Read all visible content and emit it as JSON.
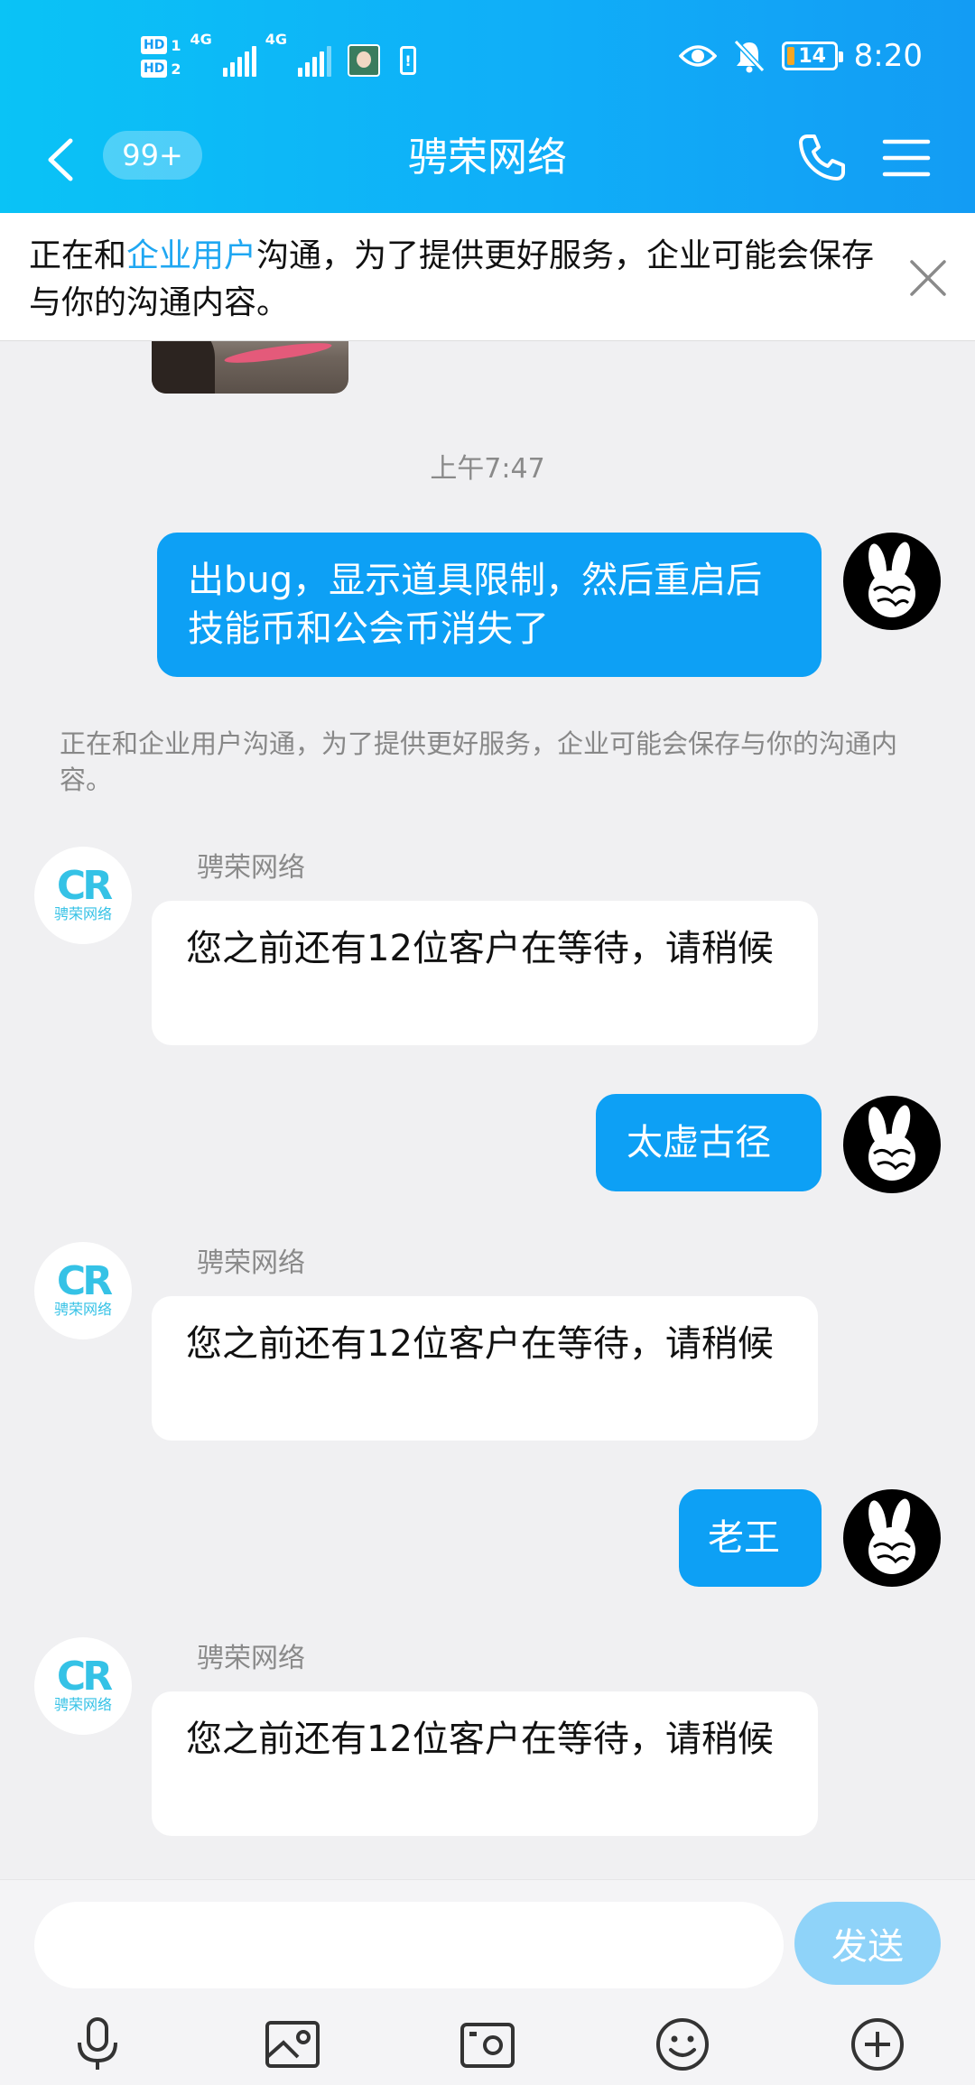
{
  "status_bar": {
    "hd1": "HD",
    "hd1_num": "1",
    "hd2": "HD",
    "hd2_num": "2",
    "network1": "4G",
    "network2": "4G",
    "battery_level": "14",
    "time": "8:20"
  },
  "header": {
    "unread_badge": "99+",
    "title": "骋荣网络"
  },
  "notice": {
    "prefix": "正在和",
    "highlight": "企业用户",
    "suffix": "沟通，为了提供更好服务，企业可能会保存与你的沟通内容。"
  },
  "chat": {
    "timestamp": "上午7:47",
    "system_note": "正在和企业用户沟通，为了提供更好服务，企业可能会保存与你的沟通内容。",
    "agent_logo_text": "骋荣网络",
    "messages": [
      {
        "from": "me",
        "text": "出bug，显示道具限制，然后重启后技能币和公会币消失了"
      },
      {
        "from": "agent",
        "sender": "骋荣网络",
        "text": "您之前还有12位客户在等待，请稍候"
      },
      {
        "from": "me",
        "text": "太虚古径"
      },
      {
        "from": "agent",
        "sender": "骋荣网络",
        "text": "您之前还有12位客户在等待，请稍候"
      },
      {
        "from": "me",
        "text": "老王"
      },
      {
        "from": "agent",
        "sender": "骋荣网络",
        "text": "您之前还有12位客户在等待，请稍候"
      }
    ]
  },
  "composer": {
    "input_value": "",
    "send_label": "发送"
  },
  "toolbar": {
    "icons": [
      "microphone-icon",
      "photo-icon",
      "camera-icon",
      "emoji-icon",
      "plus-icon"
    ]
  },
  "colors": {
    "header_gradient_start": "#0ac3f6",
    "header_gradient_end": "#139cf4",
    "outgoing_bubble": "#0da0f5",
    "notice_highlight": "#1fa7f2",
    "send_button": "#8fd3f9"
  }
}
